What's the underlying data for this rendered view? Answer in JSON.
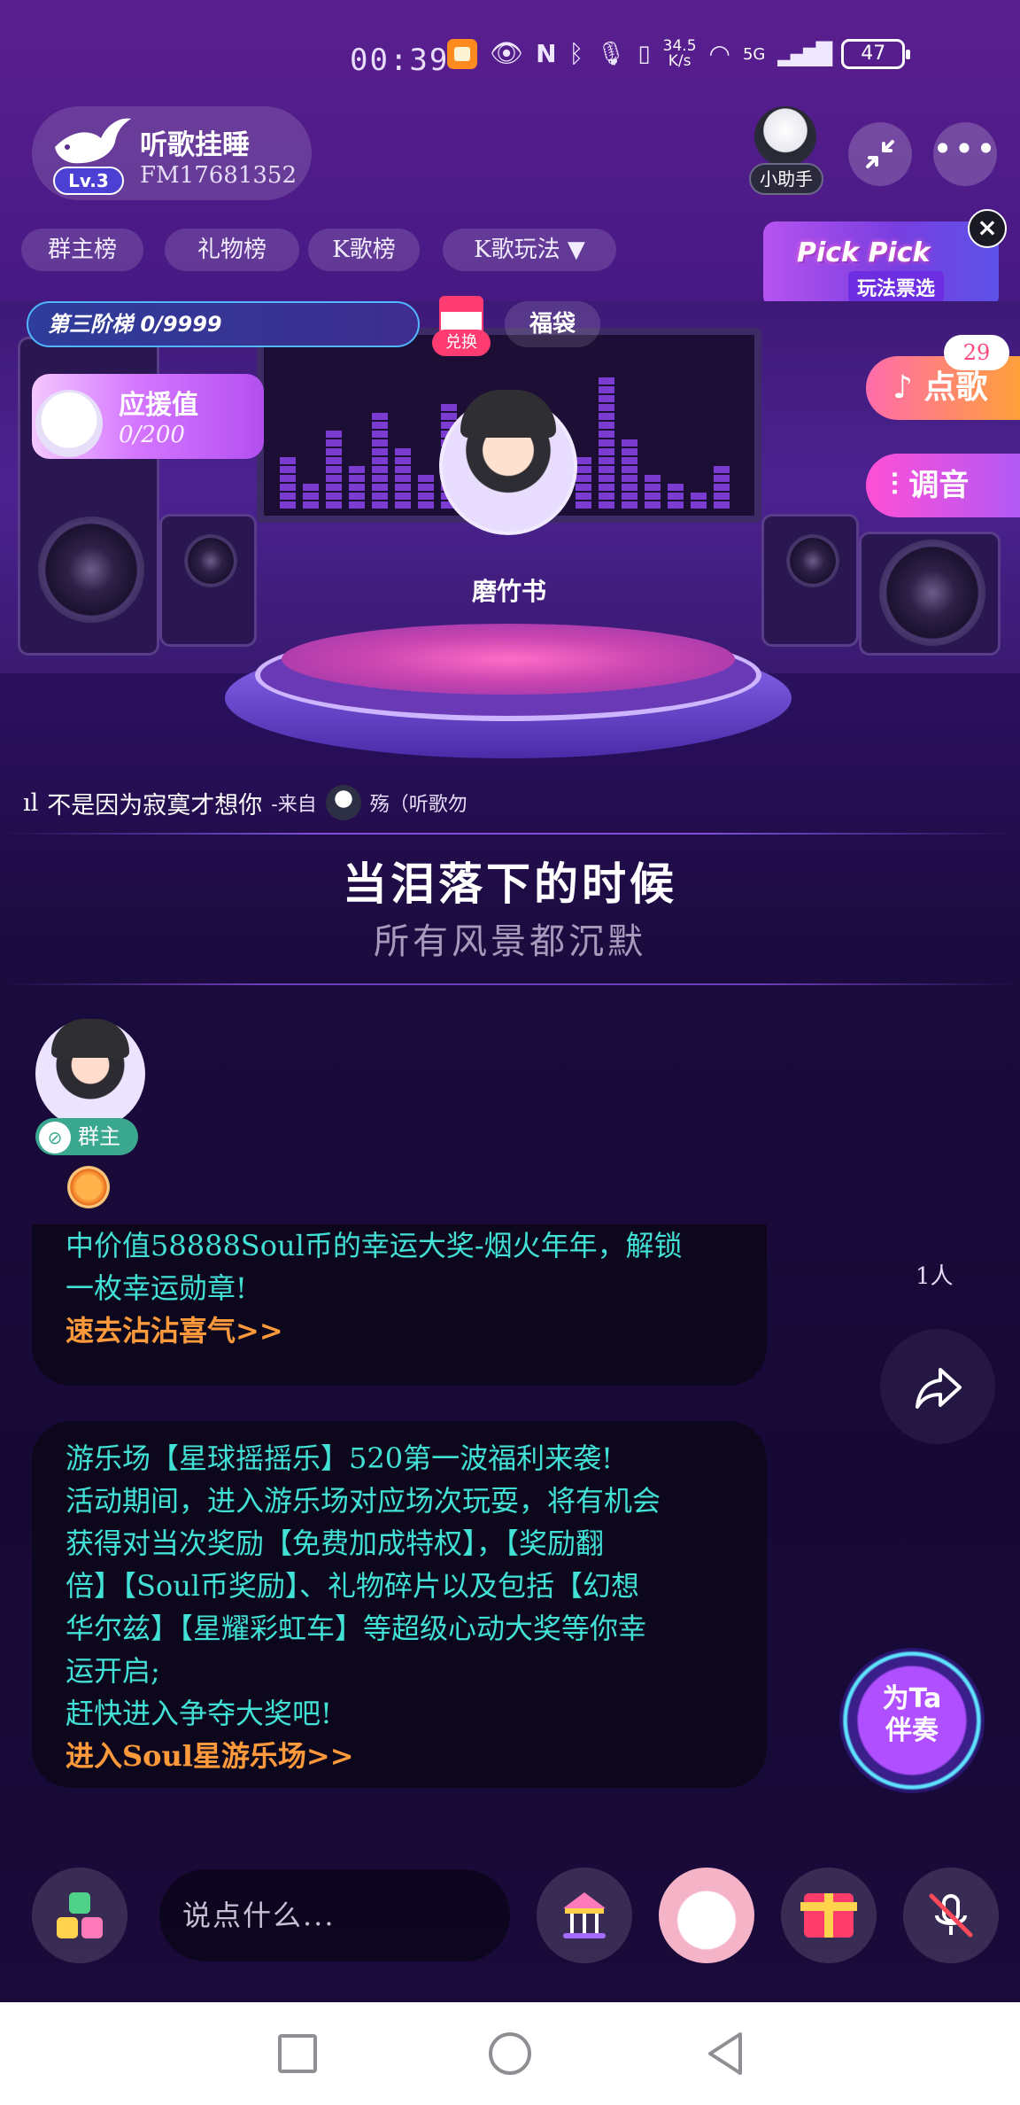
{
  "status_bar": {
    "time": "00:39",
    "net_speed_value": "34.5",
    "net_speed_unit": "K/s",
    "network": "5G",
    "battery": "47",
    "icons": [
      "app-notification-icon",
      "eye-icon",
      "nfc-icon",
      "bluetooth-icon",
      "mic-icon",
      "vibrate-icon",
      "wifi-icon",
      "signal-icon",
      "battery-icon"
    ]
  },
  "room": {
    "name": "听歌挂睡",
    "id": "FM17681352",
    "level": "Lv.3",
    "helper_label": "小助手"
  },
  "tabs": [
    "群主榜",
    "礼物榜",
    "K歌榜",
    "K歌玩法 ▼"
  ],
  "promo": {
    "title": "Pick Pick",
    "subtitle": "玩法票选",
    "close": "×"
  },
  "stage": {
    "ladder": "第三阶梯 0/9999",
    "exchange_label": "兑换",
    "lucky_bag": "福袋",
    "support_title": "应援值",
    "support_value": "0/200",
    "host_name": "磨竹书"
  },
  "right_actions": {
    "song_count": "29",
    "song_label": "点歌",
    "tune_label": "调音"
  },
  "now_playing": {
    "prefix": "ıl",
    "title": "不是因为寂寞才想你",
    "from": "-来自",
    "requester": "殇（听歌勿"
  },
  "lyrics": {
    "current": "当泪落下的时候",
    "next": "所有风景都沉默"
  },
  "owner": {
    "badge": "群主"
  },
  "messages": [
    {
      "lines": [
        "中价值58888Soul币的幸运大奖-烟火年年，解锁",
        "一枚幸运勋章!"
      ],
      "link": "速去沾沾喜气>>"
    },
    {
      "lines": [
        "游乐场【星球摇摇乐】520第一波福利来袭!",
        "活动期间，进入游乐场对应场次玩耍，将有机会",
        "获得对当次奖励【免费加成特权】，【奖励翻",
        "倍】【Soul币奖励】、礼物碎片以及包括【幻想",
        "华尔兹】【星耀彩虹车】等超级心动大奖等你幸",
        "运开启;",
        "赶快进入争夺大奖吧!"
      ],
      "link": "进入Soul星游乐场>>"
    }
  ],
  "side": {
    "listener_count": "1人"
  },
  "accompany": {
    "line1": "为Ta",
    "line2": "伴奏"
  },
  "bottom": {
    "input_placeholder": "说点什么..."
  },
  "colors": {
    "accent_cyan": "#42e1d6",
    "accent_orange": "#ff9a3c",
    "song_gradient_start": "#ff6cab",
    "tune_gradient_start": "#ff4fd6"
  }
}
